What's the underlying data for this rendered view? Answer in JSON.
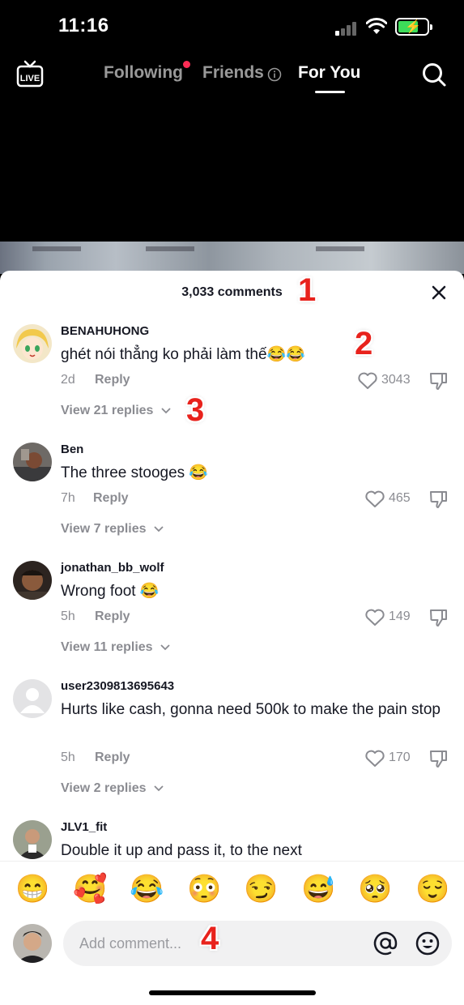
{
  "status": {
    "time": "11:16"
  },
  "topnav": {
    "live_label": "LIVE",
    "tabs": [
      {
        "label": "Following"
      },
      {
        "label": "Friends"
      },
      {
        "label": "For You"
      }
    ]
  },
  "comments_sheet": {
    "title": "3,033 comments",
    "comments": [
      {
        "username": "BENAHUHONG",
        "text": "ghét nói thẳng ko phải làm thế😂😂",
        "age": "2d",
        "reply": "Reply",
        "likes": "3043",
        "view_replies": "View 21 replies"
      },
      {
        "username": "Ben",
        "text": "The three stooges 😂",
        "age": "7h",
        "reply": "Reply",
        "likes": "465",
        "view_replies": "View 7 replies"
      },
      {
        "username": "jonathan_bb_wolf",
        "text": "Wrong foot 😂",
        "age": "5h",
        "reply": "Reply",
        "likes": "149",
        "view_replies": "View 11 replies"
      },
      {
        "username": "user2309813695643",
        "text": "Hurts like cash, gonna need 500k to make the pain stop",
        "age": "5h",
        "reply": "Reply",
        "likes": "170",
        "view_replies": "View 2 replies"
      },
      {
        "username": "JLV1_fit",
        "text": "Double it up and pass it, to the next"
      }
    ],
    "quick_emojis": [
      "😁",
      "🥰",
      "😂",
      "😳",
      "😏",
      "😅",
      "🥺",
      "😌"
    ],
    "input": {
      "placeholder": "Add comment..."
    }
  },
  "annotations": [
    "1",
    "2",
    "3",
    "4"
  ],
  "colors": {
    "accent": "#fe2c55",
    "battery": "#3ddc59",
    "annotation": "#e8221c"
  }
}
